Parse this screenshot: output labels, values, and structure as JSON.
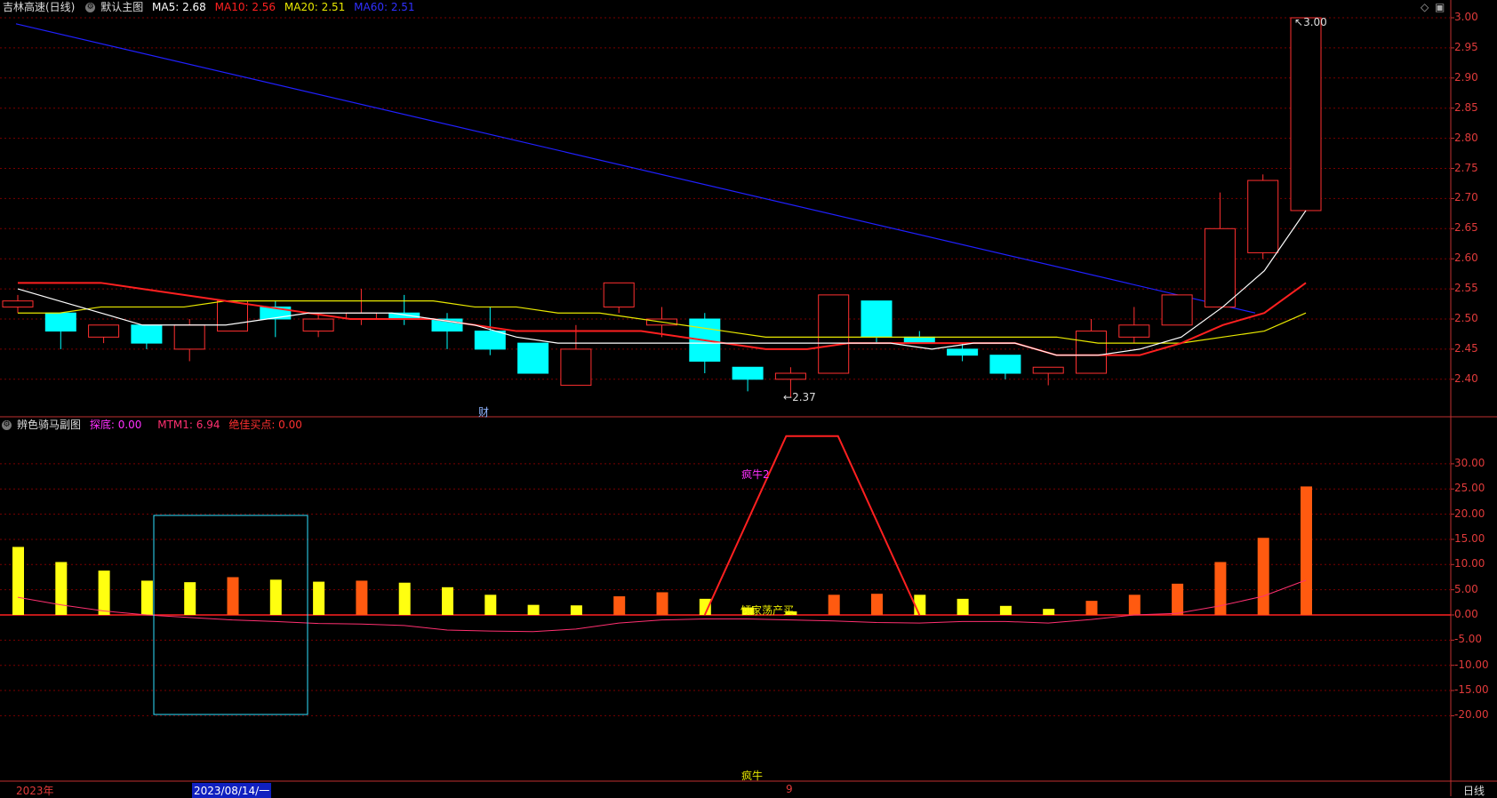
{
  "main_header": {
    "title": "吉林高速(日线)",
    "template": "默认主图",
    "ma5": "MA5: 2.68",
    "ma10": "MA10: 2.56",
    "ma20": "MA20: 2.51",
    "ma60": "MA60: 2.51"
  },
  "sub_header": {
    "title": "辨色骑马副图",
    "tanshen": "探底: 0.00",
    "mtm1": "MTM1: 6.94",
    "jiajia": "绝佳买点: 0.00"
  },
  "colors": {
    "ma5": "#ffffff",
    "ma10": "#ff2020",
    "ma20": "#e8e800",
    "ma60": "#2020ff",
    "up": "#ff3030",
    "down": "#00ffff",
    "grid": "#7a0000",
    "axis": "#c03030"
  },
  "main_axis_labels": [
    "3.00",
    "2.95",
    "2.90",
    "2.85",
    "2.80",
    "2.75",
    "2.70",
    "2.65",
    "2.60",
    "2.55",
    "2.50",
    "2.45",
    "2.40"
  ],
  "sub_axis_labels": [
    "30.00",
    "25.00",
    "20.00",
    "15.00",
    "10.00",
    "5.00",
    "0.00",
    "-5.00",
    "-10.00",
    "-15.00",
    "-20.00"
  ],
  "annotations": {
    "high": "3.00",
    "low": "2.37",
    "cai": "财",
    "fengniu2": "疯牛2",
    "qingjia": "倾家荡产买",
    "fengniu": "疯牛"
  },
  "footer": {
    "year": "2023年",
    "date_highlight": "2023/08/14/一",
    "month_mark": "9",
    "period": "日线"
  },
  "chart_data": [
    {
      "type": "candlestick",
      "title": "吉林高速(日线)",
      "ylim": [
        2.35,
        3.0
      ],
      "candles": [
        {
          "o": 2.52,
          "h": 2.54,
          "l": 2.51,
          "c": 2.53
        },
        {
          "o": 2.51,
          "h": 2.51,
          "l": 2.45,
          "c": 2.48
        },
        {
          "o": 2.47,
          "h": 2.49,
          "l": 2.46,
          "c": 2.49
        },
        {
          "o": 2.49,
          "h": 2.49,
          "l": 2.45,
          "c": 2.46
        },
        {
          "o": 2.45,
          "h": 2.5,
          "l": 2.43,
          "c": 2.49
        },
        {
          "o": 2.48,
          "h": 2.53,
          "l": 2.48,
          "c": 2.53
        },
        {
          "o": 2.52,
          "h": 2.53,
          "l": 2.47,
          "c": 2.5
        },
        {
          "o": 2.48,
          "h": 2.51,
          "l": 2.47,
          "c": 2.5
        },
        {
          "o": 2.5,
          "h": 2.55,
          "l": 2.49,
          "c": 2.51
        },
        {
          "o": 2.51,
          "h": 2.54,
          "l": 2.49,
          "c": 2.5
        },
        {
          "o": 2.5,
          "h": 2.51,
          "l": 2.45,
          "c": 2.48
        },
        {
          "o": 2.48,
          "h": 2.52,
          "l": 2.44,
          "c": 2.45
        },
        {
          "o": 2.46,
          "h": 2.46,
          "l": 2.41,
          "c": 2.41
        },
        {
          "o": 2.39,
          "h": 2.49,
          "l": 2.39,
          "c": 2.45
        },
        {
          "o": 2.52,
          "h": 2.56,
          "l": 2.51,
          "c": 2.56
        },
        {
          "o": 2.49,
          "h": 2.52,
          "l": 2.47,
          "c": 2.5
        },
        {
          "o": 2.5,
          "h": 2.51,
          "l": 2.41,
          "c": 2.43
        },
        {
          "o": 2.42,
          "h": 2.42,
          "l": 2.38,
          "c": 2.4
        },
        {
          "o": 2.4,
          "h": 2.42,
          "l": 2.37,
          "c": 2.41
        },
        {
          "o": 2.41,
          "h": 2.54,
          "l": 2.41,
          "c": 2.54
        },
        {
          "o": 2.53,
          "h": 2.53,
          "l": 2.46,
          "c": 2.47
        },
        {
          "o": 2.47,
          "h": 2.48,
          "l": 2.46,
          "c": 2.46
        },
        {
          "o": 2.45,
          "h": 2.46,
          "l": 2.43,
          "c": 2.44
        },
        {
          "o": 2.44,
          "h": 2.44,
          "l": 2.4,
          "c": 2.41
        },
        {
          "o": 2.41,
          "h": 2.42,
          "l": 2.39,
          "c": 2.42
        },
        {
          "o": 2.41,
          "h": 2.5,
          "l": 2.41,
          "c": 2.48
        },
        {
          "o": 2.47,
          "h": 2.52,
          "l": 2.46,
          "c": 2.49
        },
        {
          "o": 2.49,
          "h": 2.54,
          "l": 2.49,
          "c": 2.54
        },
        {
          "o": 2.52,
          "h": 2.71,
          "l": 2.52,
          "c": 2.65
        },
        {
          "o": 2.61,
          "h": 2.74,
          "l": 2.6,
          "c": 2.73
        },
        {
          "o": 2.68,
          "h": 3.0,
          "l": 2.68,
          "c": 3.0
        }
      ],
      "ma5": [
        2.55,
        2.53,
        2.51,
        2.49,
        2.49,
        2.49,
        2.5,
        2.51,
        2.51,
        2.51,
        2.5,
        2.49,
        2.47,
        2.46,
        2.46,
        2.46,
        2.46,
        2.46,
        2.46,
        2.46,
        2.46,
        2.46,
        2.45,
        2.46,
        2.46,
        2.44,
        2.44,
        2.45,
        2.47,
        2.52,
        2.58,
        2.68
      ],
      "ma10": [
        2.56,
        2.56,
        2.56,
        2.55,
        2.54,
        2.53,
        2.52,
        2.51,
        2.5,
        2.5,
        2.5,
        2.49,
        2.48,
        2.48,
        2.48,
        2.48,
        2.47,
        2.46,
        2.45,
        2.45,
        2.46,
        2.46,
        2.46,
        2.46,
        2.46,
        2.44,
        2.44,
        2.44,
        2.46,
        2.49,
        2.51,
        2.56
      ],
      "ma20": [
        2.51,
        2.51,
        2.52,
        2.52,
        2.52,
        2.53,
        2.53,
        2.53,
        2.53,
        2.53,
        2.53,
        2.52,
        2.52,
        2.51,
        2.51,
        2.5,
        2.49,
        2.48,
        2.47,
        2.47,
        2.47,
        2.47,
        2.47,
        2.47,
        2.47,
        2.47,
        2.46,
        2.46,
        2.46,
        2.47,
        2.48,
        2.51
      ],
      "ma60_start": 2.99,
      "ma60_end": 2.51
    },
    {
      "type": "bar",
      "title": "辨色骑马副图",
      "ylim": [
        -25,
        38
      ],
      "values": [
        13.5,
        10.5,
        8.8,
        6.8,
        6.5,
        7.5,
        7.0,
        6.6,
        6.8,
        6.4,
        5.5,
        4.0,
        2.0,
        1.9,
        3.7,
        4.5,
        3.2,
        1.5,
        0.7,
        4.0,
        4.2,
        4.0,
        3.2,
        1.8,
        1.2,
        2.8,
        4.0,
        6.2,
        10.5,
        15.3,
        25.5
      ],
      "colors": [
        "y",
        "y",
        "y",
        "y",
        "y",
        "o",
        "y",
        "y",
        "o",
        "y",
        "y",
        "y",
        "y",
        "y",
        "o",
        "o",
        "y",
        "y",
        "y",
        "o",
        "o",
        "y",
        "y",
        "y",
        "y",
        "o",
        "o",
        "o",
        "o",
        "o",
        "o"
      ],
      "mtm_line": [
        3.5,
        2.0,
        0.8,
        0,
        -0.5,
        -1.0,
        -1.3,
        -1.7,
        -1.8,
        -2.1,
        -3.0,
        -3.2,
        -3.3,
        -2.8,
        -1.6,
        -1.0,
        -0.8,
        -0.8,
        -1.0,
        -1.2,
        -1.5,
        -1.6,
        -1.3,
        -1.3,
        -1.6,
        -0.9,
        0.0,
        0.3,
        1.8,
        3.7,
        6.9
      ],
      "tanshen_line": {
        "from_index": 16,
        "peak_start": 18,
        "peak_end": 19,
        "to_index": 21,
        "peak": 35.5
      }
    }
  ]
}
